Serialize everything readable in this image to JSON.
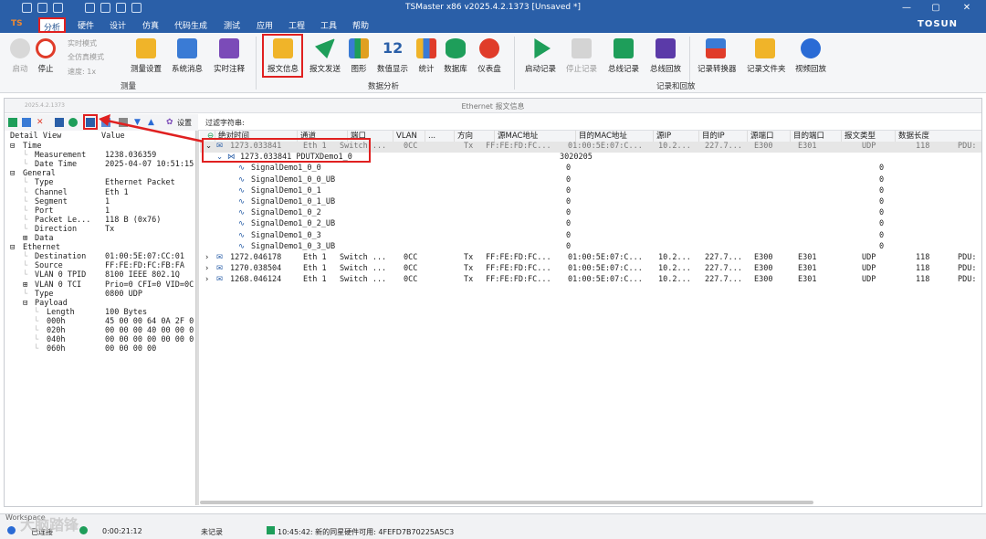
{
  "window": {
    "title": "TSMaster x86 v2025.4.2.1373 [Unsaved *]",
    "brand": "TOSUN"
  },
  "menu": [
    "分析",
    "硬件",
    "设计",
    "仿真",
    "代码生成",
    "测试",
    "应用",
    "工程",
    "工具",
    "帮助"
  ],
  "ribbon": {
    "measure": {
      "start": "启动",
      "stop": "停止",
      "realtime": "实时模式",
      "fullsim": "全仿真模式",
      "speed": "速度: 1x",
      "settings": "测量设置",
      "sysmsg": "系统消息",
      "rtcomment": "实时注释",
      "group": "测量"
    },
    "analysis": {
      "items": [
        "报文信息",
        "报文发送",
        "图形",
        "数值显示",
        "统计",
        "数据库",
        "仪表盘"
      ],
      "group": "数据分析"
    },
    "record": {
      "items": [
        "启动记录",
        "停止记录",
        "总线记录",
        "总线回放",
        "记录转换器",
        "记录文件夹",
        "视频回放"
      ],
      "group": "记录和回放"
    }
  },
  "panel": {
    "title": "Ethernet 报文信息",
    "version": "2025.4.2.1373",
    "settings": "设置",
    "filter": "过滤字符串:"
  },
  "tree": {
    "headers": [
      "Detail View",
      "Value"
    ],
    "rows": [
      {
        "label": "Time",
        "value": "",
        "level": 0,
        "exp": "⊟"
      },
      {
        "label": "Measurement",
        "value": "1238.036359",
        "level": 1
      },
      {
        "label": "Date Time",
        "value": "2025-04-07 10:51:15",
        "level": 1
      },
      {
        "label": "General",
        "value": "",
        "level": 0,
        "exp": "⊟"
      },
      {
        "label": "Type",
        "value": "Ethernet Packet",
        "level": 1
      },
      {
        "label": "Channel",
        "value": "Eth 1",
        "level": 1
      },
      {
        "label": "Segment",
        "value": "1",
        "level": 1
      },
      {
        "label": "Port",
        "value": "1",
        "level": 1
      },
      {
        "label": "Packet Le...",
        "value": "118 B (0x76)",
        "level": 1
      },
      {
        "label": "Direction",
        "value": "Tx",
        "level": 1
      },
      {
        "label": "Data",
        "value": "",
        "level": 1,
        "exp": "⊞"
      },
      {
        "label": "Ethernet",
        "value": "",
        "level": 0,
        "exp": "⊟"
      },
      {
        "label": "Destination",
        "value": "01:00:5E:07:CC:01",
        "level": 1
      },
      {
        "label": "Source",
        "value": "FF:FE:FD:FC:FB:FA",
        "level": 1
      },
      {
        "label": "VLAN 0 TPID",
        "value": "8100 IEEE 802.1Q",
        "level": 1
      },
      {
        "label": "VLAN 0 TCI",
        "value": "Prio=0 CFI=0 VID=0C",
        "level": 1,
        "exp": "⊞"
      },
      {
        "label": "Type",
        "value": "0800 UDP",
        "level": 1
      },
      {
        "label": "Payload",
        "value": "",
        "level": 1,
        "exp": "⊟"
      },
      {
        "label": "Length",
        "value": "100 Bytes",
        "level": 2
      },
      {
        "label": "000h",
        "value": "45 00 00 64 0A 2F 0",
        "level": 2
      },
      {
        "label": "020h",
        "value": "00 00 00 40 00 00 0",
        "level": 2
      },
      {
        "label": "040h",
        "value": "00 00 00 00 00 00 0",
        "level": 2
      },
      {
        "label": "060h",
        "value": "00 00 00 00",
        "level": 2
      }
    ]
  },
  "grid": {
    "headers": [
      "绝对时间",
      "通道",
      "端口",
      "VLAN",
      "...",
      "方向",
      "源MAC地址",
      "目的MAC地址",
      "源IP",
      "目的IP",
      "源端口",
      "目的端口",
      "报文类型",
      "数据长度"
    ],
    "rows": [
      {
        "time": "1273.033841",
        "ch": "Eth 1",
        "port": "Switch ...",
        "vlan": "0CC",
        "dir": "Tx",
        "src": "FF:FE:FD:FC...",
        "dst": "01:00:5E:07:C...",
        "sip": "10.2...",
        "dip": "227.7...",
        "sport": "E300",
        "dport": "E301",
        "type": "UDP",
        "len": "118",
        "pdu": "PDU:"
      },
      {
        "pdu_name": "1273.033841  PDUTXDemo1_0",
        "pdu_val": "3020205"
      },
      {
        "sig": "SignalDemo1_0_0",
        "v1": "0",
        "v2": "0"
      },
      {
        "sig": "SignalDemo1_0_0_UB",
        "v1": "0",
        "v2": "0"
      },
      {
        "sig": "SignalDemo1_0_1",
        "v1": "0",
        "v2": "0"
      },
      {
        "sig": "SignalDemo1_0_1_UB",
        "v1": "0",
        "v2": "0"
      },
      {
        "sig": "SignalDemo1_0_2",
        "v1": "0",
        "v2": "0"
      },
      {
        "sig": "SignalDemo1_0_2_UB",
        "v1": "0",
        "v2": "0"
      },
      {
        "sig": "SignalDemo1_0_3",
        "v1": "0",
        "v2": "0"
      },
      {
        "sig": "SignalDemo1_0_3_UB",
        "v1": "0",
        "v2": "0"
      },
      {
        "time": "1272.046178",
        "ch": "Eth 1",
        "port": "Switch ...",
        "vlan": "0CC",
        "dir": "Tx",
        "src": "FF:FE:FD:FC...",
        "dst": "01:00:5E:07:C...",
        "sip": "10.2...",
        "dip": "227.7...",
        "sport": "E300",
        "dport": "E301",
        "type": "UDP",
        "len": "118",
        "pdu": "PDU:"
      },
      {
        "time": "1270.038504",
        "ch": "Eth 1",
        "port": "Switch ...",
        "vlan": "0CC",
        "dir": "Tx",
        "src": "FF:FE:FD:FC...",
        "dst": "01:00:5E:07:C...",
        "sip": "10.2...",
        "dip": "227.7...",
        "sport": "E300",
        "dport": "E301",
        "type": "UDP",
        "len": "118",
        "pdu": "PDU:"
      },
      {
        "time": "1268.046124",
        "ch": "Eth 1",
        "port": "Switch ...",
        "vlan": "0CC",
        "dir": "Tx",
        "src": "FF:FE:FD:FC...",
        "dst": "01:00:5E:07:C...",
        "sip": "10.2...",
        "dip": "227.7...",
        "sport": "E300",
        "dport": "E301",
        "type": "UDP",
        "len": "118",
        "pdu": "PDU:"
      }
    ]
  },
  "status": {
    "tab": "Workspace",
    "conn": "已连接",
    "time": "0:00:21:12",
    "rec": "未记录",
    "msg": "10:45:42: 新的同星硬件可用: 4FEFD7B70225A5C3",
    "watermark": "大脑踏锋"
  },
  "colors": {
    "titlebar": "#2a5fa8",
    "highlight": "#e02020"
  }
}
